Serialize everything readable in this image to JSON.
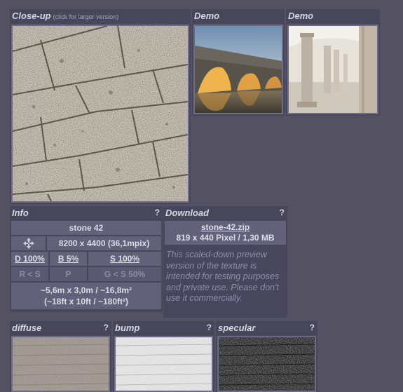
{
  "closeup": {
    "title": "Close-up",
    "hint": "(click for larger version)"
  },
  "demo1": {
    "title": "Demo"
  },
  "demo2": {
    "title": "Demo"
  },
  "info": {
    "title": "Info",
    "help": "?",
    "name": "stone 42",
    "resolution": "8200 x 4400 (36,1mpix)",
    "move_icon": "move-icon",
    "maps": {
      "d": "D 100%",
      "b": "B 5%",
      "s": "S 100%"
    },
    "row4": {
      "rs": "R < S",
      "p": "P",
      "gs": "G < S 50%"
    },
    "size_metric": "~5,6m x 3,0m / ~16,8m²",
    "size_imperial": "(~18ft x 10ft / ~180ft²)"
  },
  "download": {
    "title": "Download",
    "help": "?",
    "file": "stone-42.zip",
    "fileinfo": "819 x 440 Pixel / 1,30 MB",
    "notice": "This scaled-down preview version of the texture is intended for testing purposes and private use. Please don't use it commercially."
  },
  "maps": {
    "diffuse": {
      "title": "diffuse",
      "help": "?"
    },
    "bump": {
      "title": "bump",
      "help": "?"
    },
    "specular": {
      "title": "specular",
      "help": "?"
    }
  }
}
